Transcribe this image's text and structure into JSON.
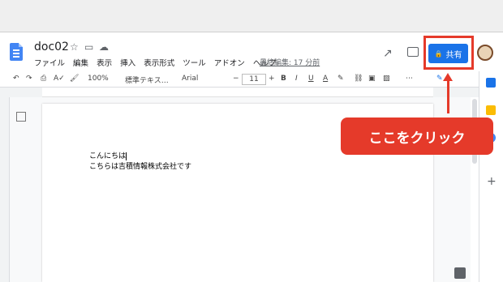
{
  "doc": {
    "title": "doc02",
    "menus": [
      "ファイル",
      "編集",
      "表示",
      "挿入",
      "表示形式",
      "ツール",
      "アドオン",
      "ヘルプ"
    ],
    "last_edit": "最終編集: 17 分前"
  },
  "share_label": "共有",
  "toolbar": {
    "zoom": "100%",
    "style": "標準テキス…",
    "font": "Arial",
    "font_size": "11",
    "bold": "B",
    "italic": "I",
    "underline": "U",
    "text_color": "A"
  },
  "body": {
    "line1": "こんにちは",
    "line2": "こちらは吉積情報株式会社です"
  },
  "callout": "ここをクリック",
  "colors": {
    "accent_red": "#e53a2a",
    "share_blue": "#1a73e8"
  }
}
